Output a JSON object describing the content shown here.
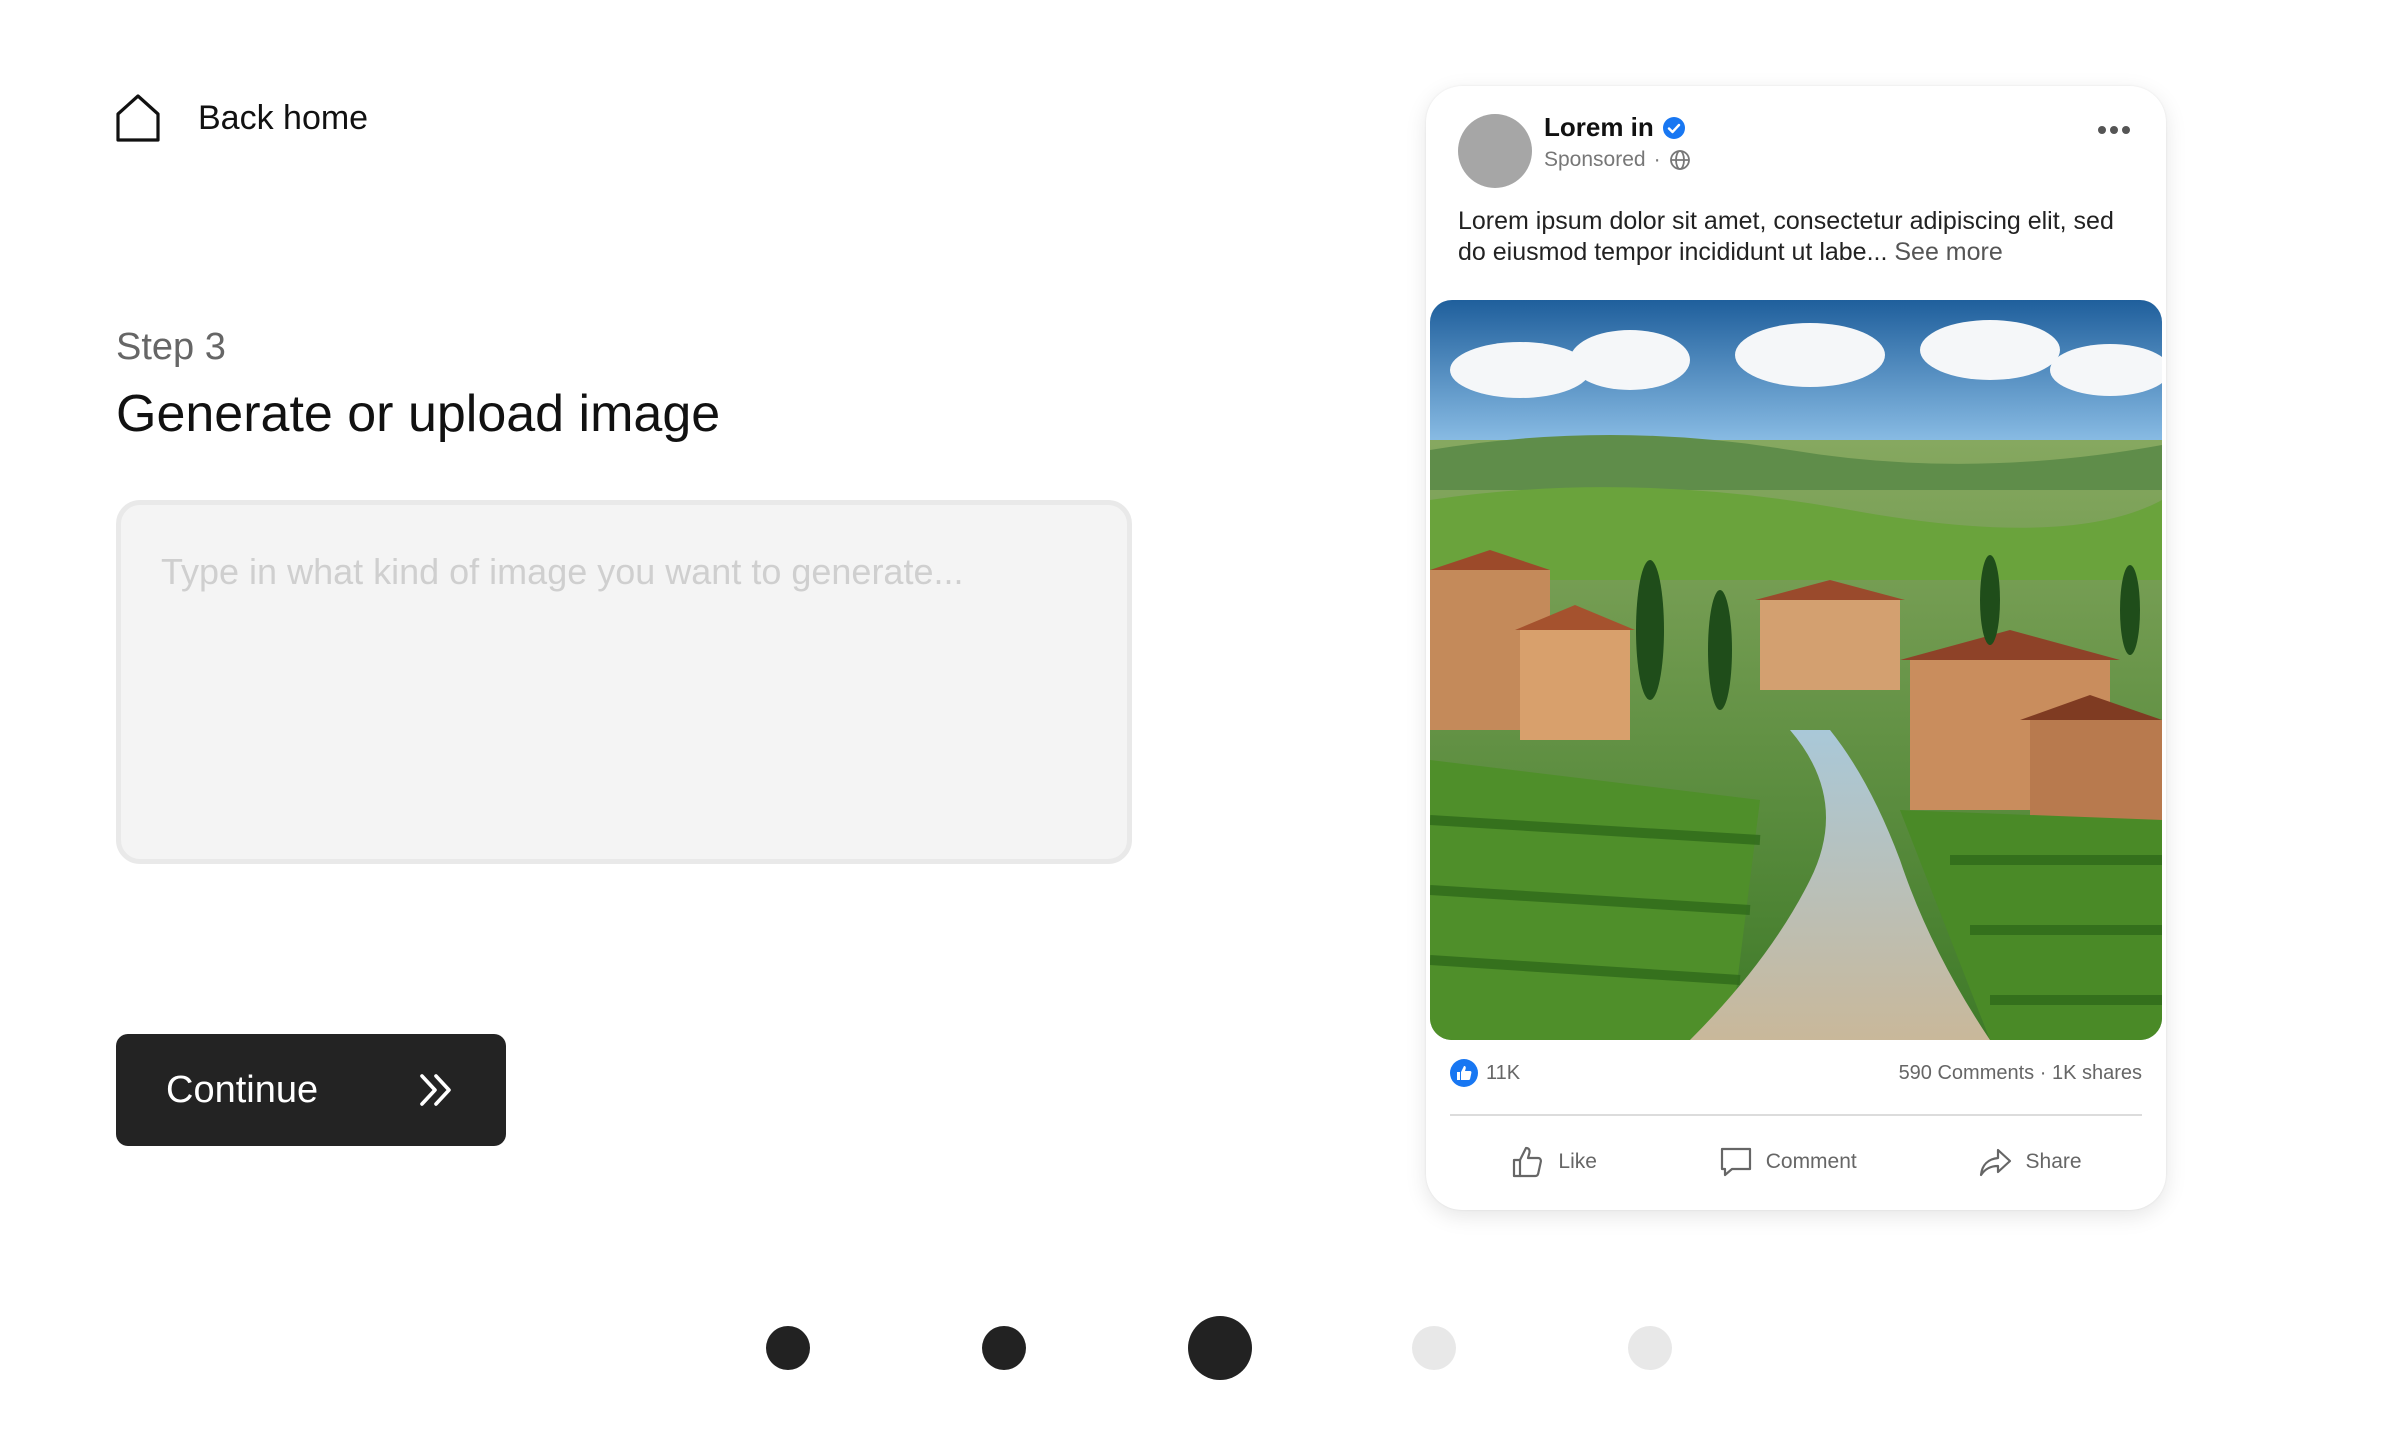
{
  "nav": {
    "back_label": "Back home"
  },
  "step": {
    "label": "Step 3",
    "title": "Generate or upload image"
  },
  "prompt": {
    "placeholder": "Type in what kind of image you want to generate...",
    "value": ""
  },
  "continue_label": "Continue",
  "post": {
    "page_name": "Lorem in",
    "sponsored": "Sponsored",
    "separator": "·",
    "body": "Lorem ipsum dolor sit amet, consectetur adipiscing elit, sed do eiusmod tempor incididunt ut labe...",
    "see_more": "See more",
    "likes": "11K",
    "comments_shares": "590 Comments · 1K shares",
    "actions": {
      "like": "Like",
      "comment": "Comment",
      "share": "Share"
    },
    "image_description": "Tuscan countryside village with vineyards and a winding path"
  },
  "progress": {
    "total_steps": 5,
    "current_step": 3,
    "colors": {
      "done": "#222222",
      "pending": "#e8e8e8"
    }
  },
  "colors": {
    "accent": "#1877f2",
    "button_bg": "#232323",
    "text": "#111111"
  },
  "icons": [
    "home-icon",
    "double-chevron-right-icon",
    "verified-badge-icon",
    "globe-icon",
    "more-icon",
    "thumbs-up-icon",
    "comment-icon",
    "share-icon"
  ]
}
